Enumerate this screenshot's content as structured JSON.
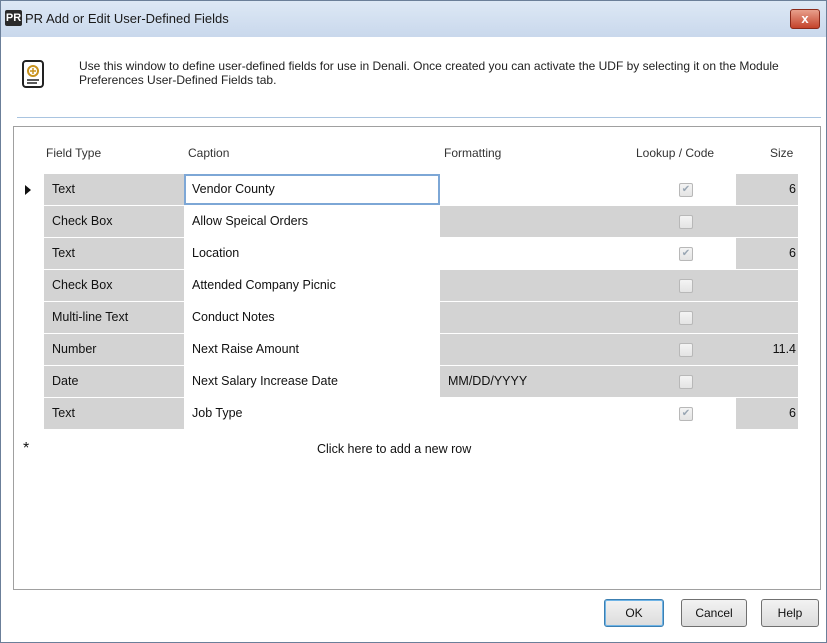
{
  "window": {
    "icon_label": "PR",
    "title": "PR Add or Edit User-Defined Fields",
    "close_label": "x"
  },
  "info": {
    "text": "Use this window to define user-defined fields for use in Denali. Once created you can activate the UDF by selecting it on the Module Preferences User-Defined Fields tab."
  },
  "grid": {
    "headers": {
      "field_type": "Field Type",
      "caption": "Caption",
      "formatting": "Formatting",
      "lookup": "Lookup / Code",
      "size": "Size"
    },
    "rows": [
      {
        "field_type": "Text",
        "caption": "Vendor County",
        "formatting": "",
        "lookup": true,
        "size": "6"
      },
      {
        "field_type": "Check Box",
        "caption": "Allow Speical Orders",
        "formatting": "",
        "lookup": false,
        "size": ""
      },
      {
        "field_type": "Text",
        "caption": "Location",
        "formatting": "",
        "lookup": true,
        "size": "6"
      },
      {
        "field_type": "Check Box",
        "caption": "Attended Company Picnic",
        "formatting": "",
        "lookup": false,
        "size": ""
      },
      {
        "field_type": "Multi-line Text",
        "caption": "Conduct Notes",
        "formatting": "",
        "lookup": false,
        "size": ""
      },
      {
        "field_type": "Number",
        "caption": "Next Raise Amount",
        "formatting": "",
        "lookup": false,
        "size": "11.4"
      },
      {
        "field_type": "Date",
        "caption": "Next Salary Increase Date",
        "formatting": "MM/DD/YYYY",
        "lookup": false,
        "size": ""
      },
      {
        "field_type": "Text",
        "caption": "Job Type",
        "formatting": "",
        "lookup": true,
        "size": "6"
      }
    ],
    "new_row_text": "Click here to add a new row",
    "new_row_marker": "*"
  },
  "buttons": {
    "ok": "OK",
    "cancel": "Cancel",
    "help": "Help"
  }
}
